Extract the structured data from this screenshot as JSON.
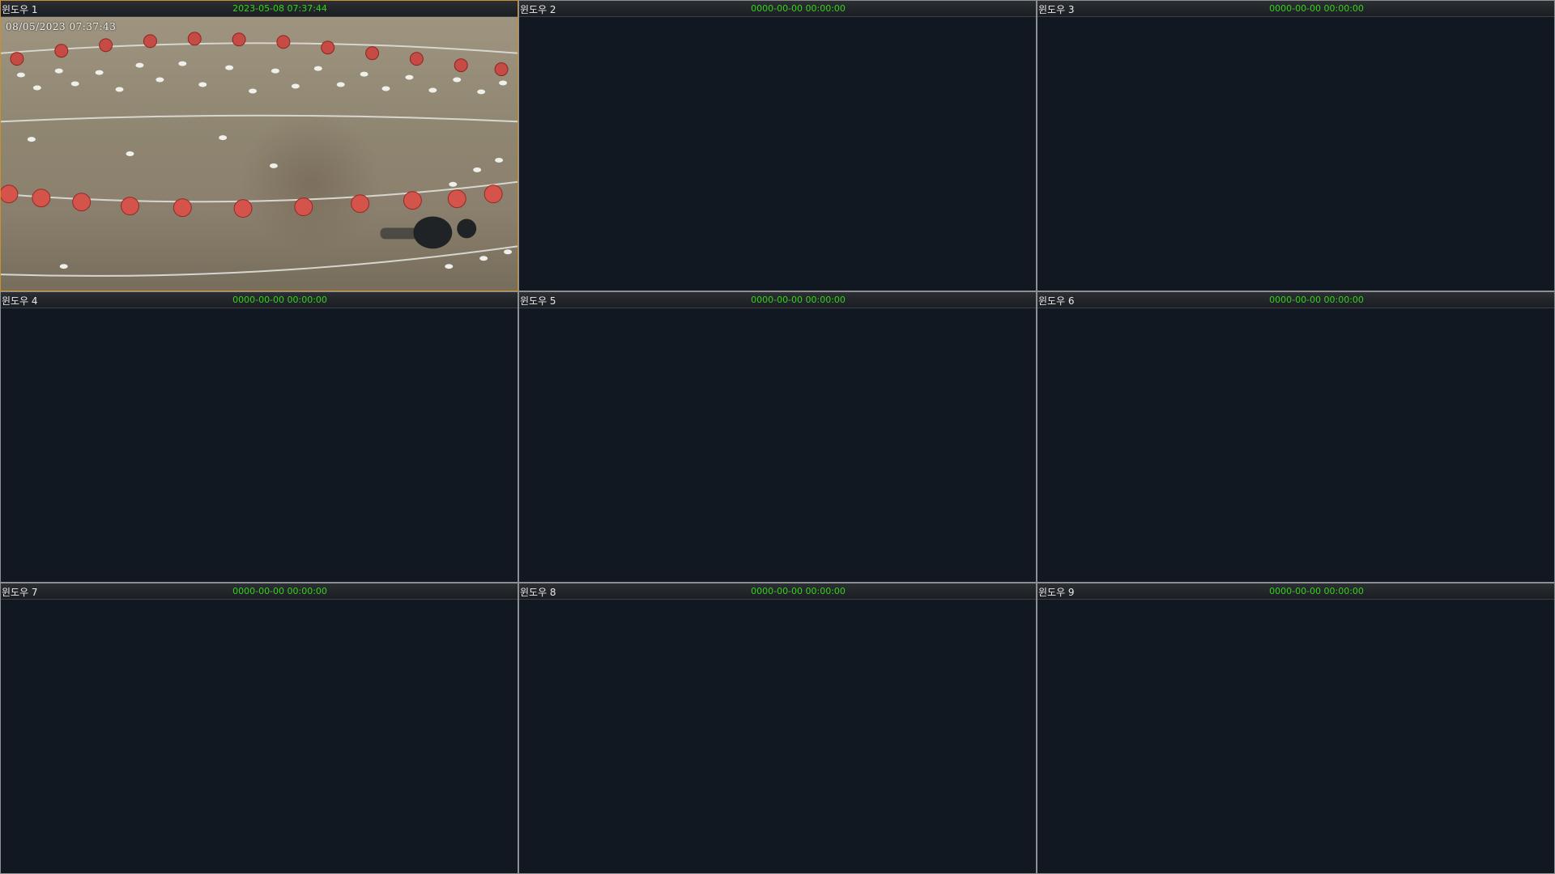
{
  "windows": [
    {
      "label": "윈도우 1",
      "time": "2023-05-08 07:37:44",
      "overlay_time": "08/05/2023 07:37:43",
      "active": true,
      "has_feed": true
    },
    {
      "label": "윈도우 2",
      "time": "0000-00-00 00:00:00",
      "active": false,
      "has_feed": false
    },
    {
      "label": "윈도우 3",
      "time": "0000-00-00 00:00:00",
      "active": false,
      "has_feed": false
    },
    {
      "label": "윈도우 4",
      "time": "0000-00-00 00:00:00",
      "active": false,
      "has_feed": false
    },
    {
      "label": "윈도우 5",
      "time": "0000-00-00 00:00:00",
      "active": false,
      "has_feed": false
    },
    {
      "label": "윈도우 6",
      "time": "0000-00-00 00:00:00",
      "active": false,
      "has_feed": false
    },
    {
      "label": "윈도우 7",
      "time": "0000-00-00 00:00:00",
      "active": false,
      "has_feed": false
    },
    {
      "label": "윈도우 8",
      "time": "0000-00-00 00:00:00",
      "active": false,
      "has_feed": false
    },
    {
      "label": "윈도우 9",
      "time": "0000-00-00 00:00:00",
      "active": false,
      "has_feed": false
    }
  ],
  "colors": {
    "timestamp": "#35d21b",
    "active_border": "#c9902e",
    "empty_tile": "#121821"
  }
}
